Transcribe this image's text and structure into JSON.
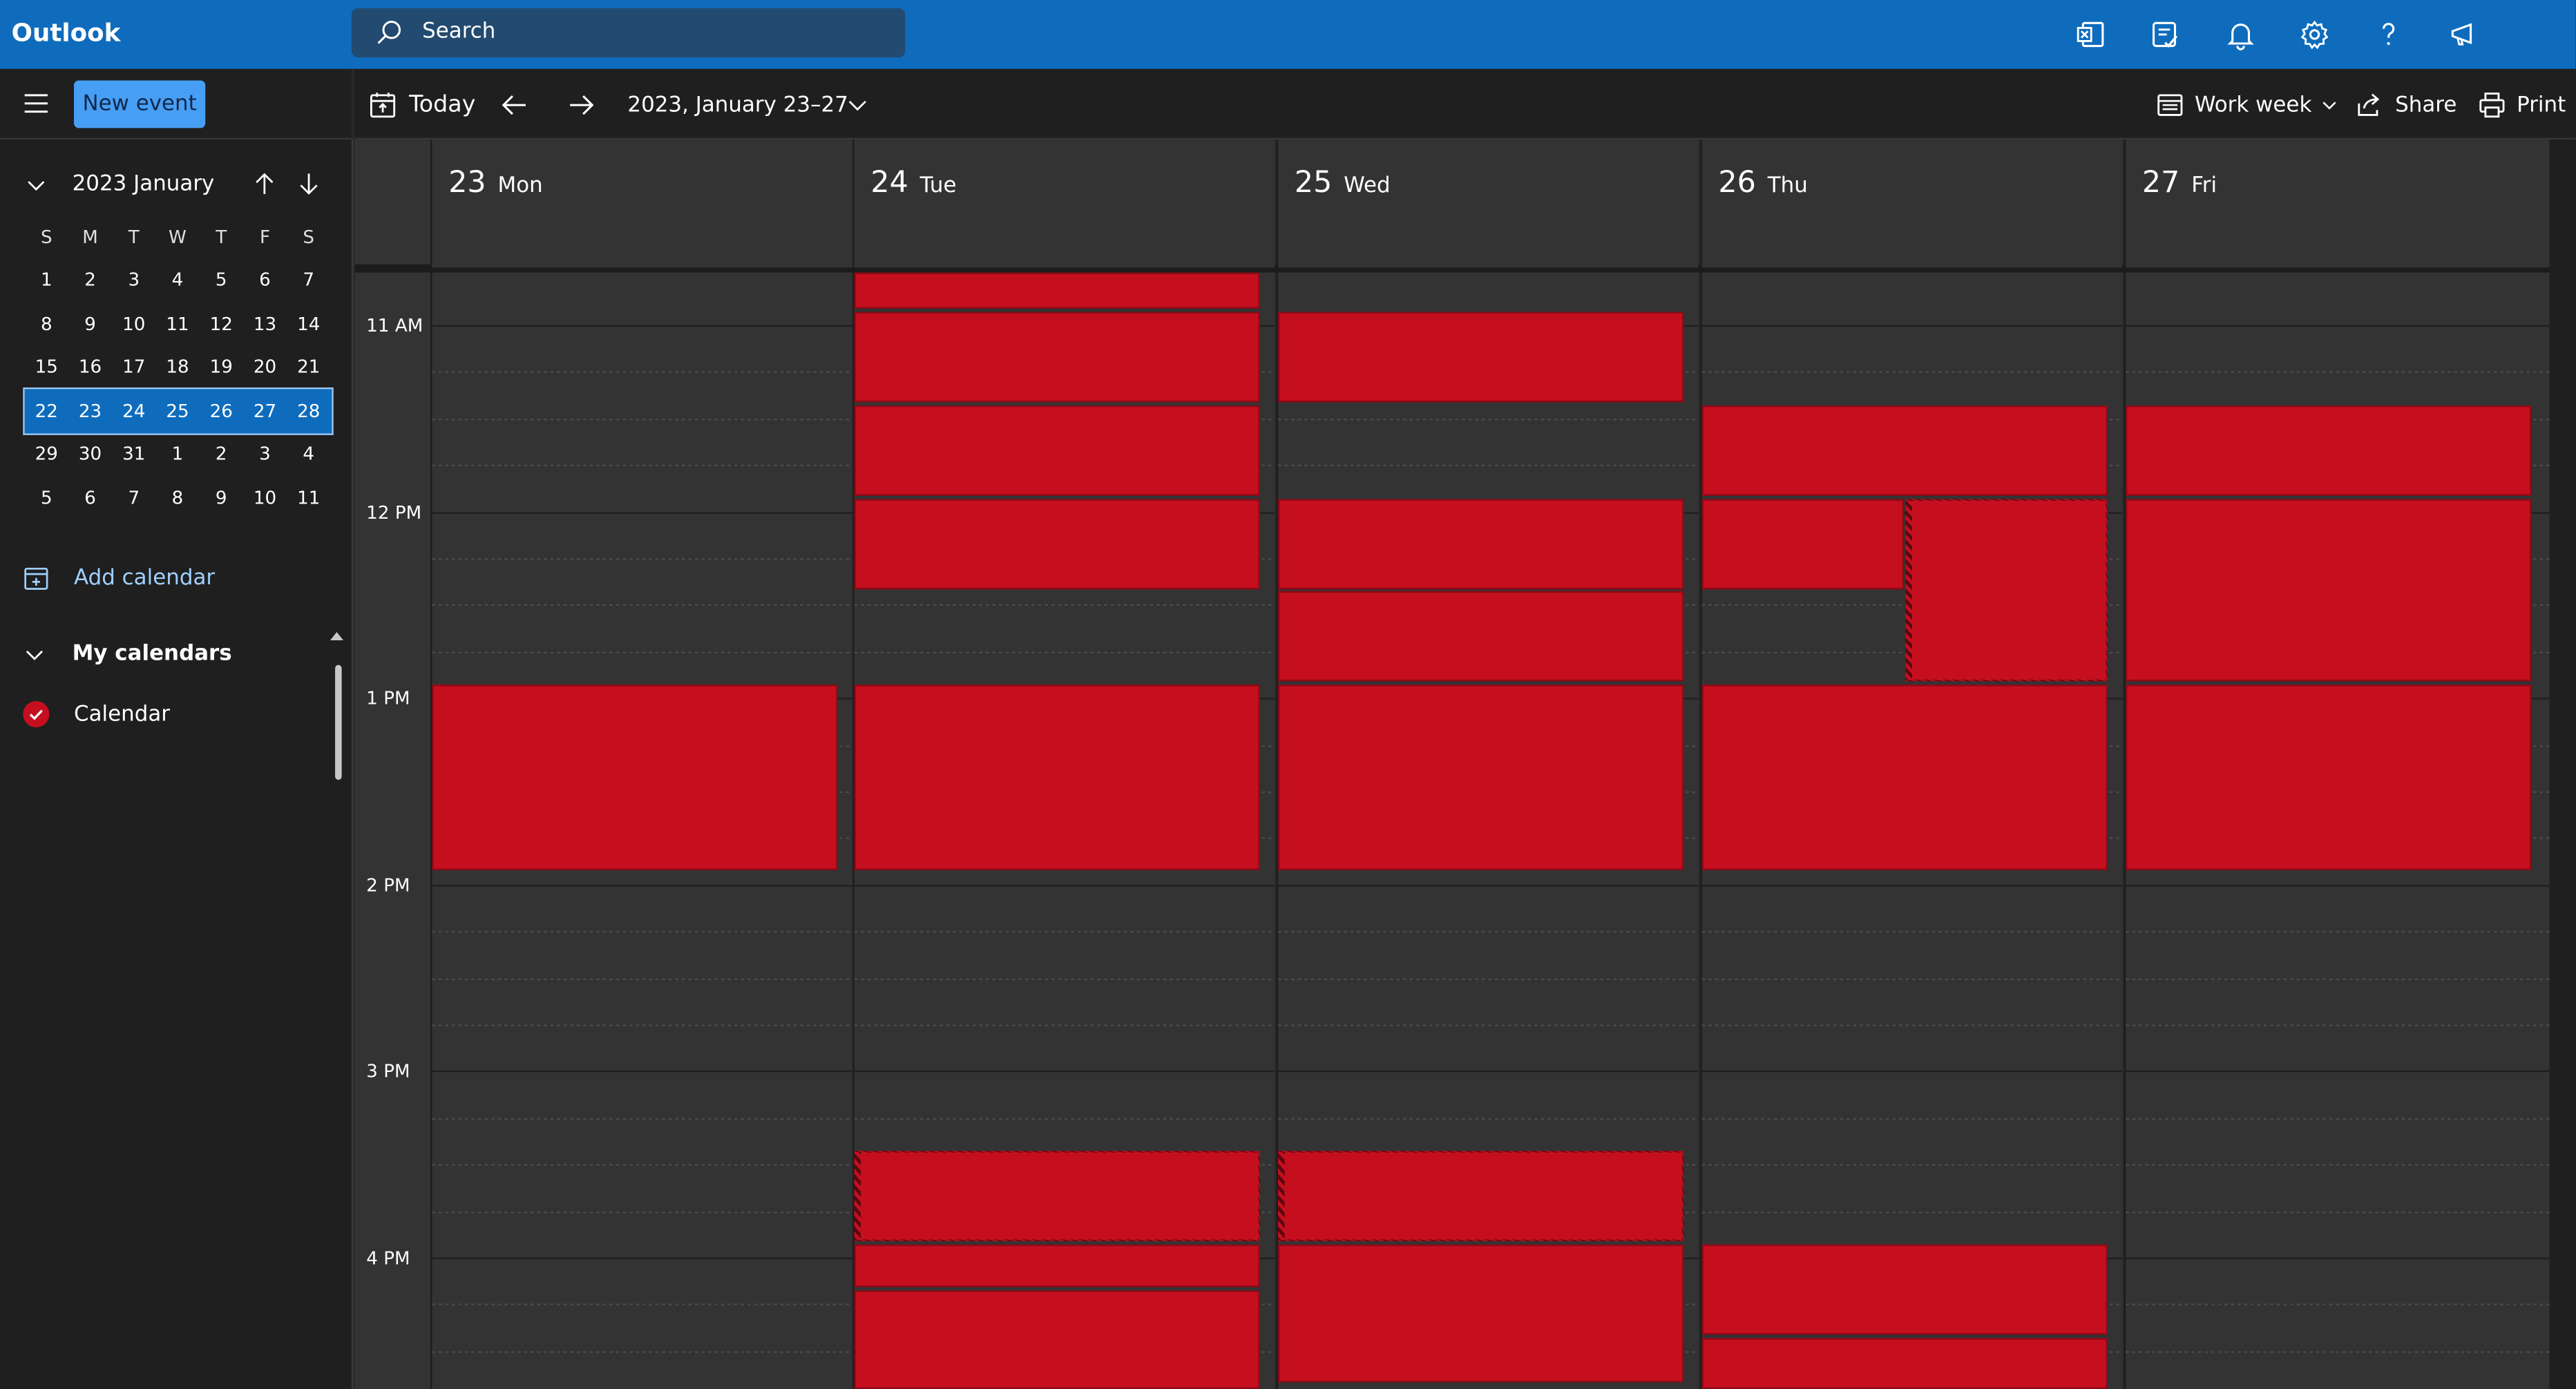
{
  "app": {
    "name": "Outlook"
  },
  "search": {
    "placeholder": "Search"
  },
  "top_icons": [
    "excel-icon",
    "todo-icon",
    "bell-icon",
    "gear-icon",
    "help-icon",
    "feedback-icon"
  ],
  "toolbar": {
    "new_event": "New event",
    "today": "Today",
    "date_range": "2023, January 23–27",
    "view": "Work week",
    "share": "Share",
    "print": "Print"
  },
  "mini_calendar": {
    "title": "2023 January",
    "days_of_week": [
      "S",
      "M",
      "T",
      "W",
      "T",
      "F",
      "S"
    ],
    "weeks": [
      [
        "1",
        "2",
        "3",
        "4",
        "5",
        "6",
        "7"
      ],
      [
        "8",
        "9",
        "10",
        "11",
        "12",
        "13",
        "14"
      ],
      [
        "15",
        "16",
        "17",
        "18",
        "19",
        "20",
        "21"
      ],
      [
        "22",
        "23",
        "24",
        "25",
        "26",
        "27",
        "28"
      ],
      [
        "29",
        "30",
        "31",
        "1",
        "2",
        "3",
        "4"
      ],
      [
        "5",
        "6",
        "7",
        "8",
        "9",
        "10",
        "11"
      ]
    ],
    "selected_week_index": 3
  },
  "sidebar": {
    "add_calendar": "Add calendar",
    "my_calendars": "My calendars",
    "calendars": [
      "Calendar"
    ]
  },
  "days": [
    {
      "num": "23",
      "name": "Mon"
    },
    {
      "num": "24",
      "name": "Tue"
    },
    {
      "num": "25",
      "name": "Wed"
    },
    {
      "num": "26",
      "name": "Thu"
    },
    {
      "num": "27",
      "name": "Fri"
    }
  ],
  "time_labels": [
    "11 AM",
    "12 PM",
    "1 PM",
    "2 PM",
    "3 PM",
    "4 PM"
  ],
  "colors": {
    "brand": "#0f6cbd",
    "event": "#c50f1f",
    "button": "#479ef5"
  }
}
